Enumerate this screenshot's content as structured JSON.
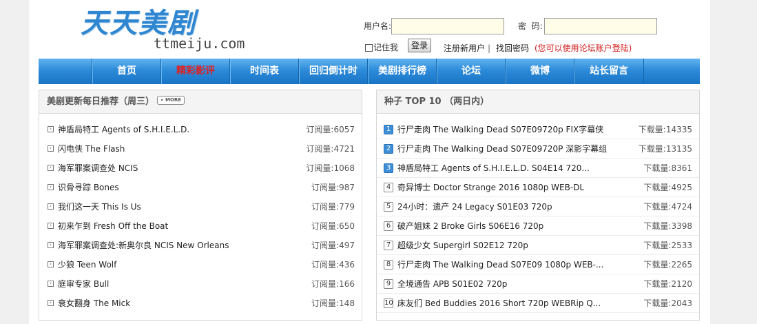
{
  "site": {
    "logo_cn": "天天美剧",
    "logo_en": "ttmeiju.com"
  },
  "login": {
    "username_label": "用户名:",
    "password_label": "密  码:",
    "remember_label": "记住我",
    "login_button": "登录",
    "register_link": "注册新用户",
    "separator": "|",
    "forgot_link": "找回密码",
    "forum_note": "(您可以使用论坛账户登陆)"
  },
  "nav": {
    "items": [
      {
        "label": "首页"
      },
      {
        "label": "精彩影评"
      },
      {
        "label": "时间表"
      },
      {
        "label": "回归倒计时"
      },
      {
        "label": "美剧排行榜"
      },
      {
        "label": "论坛"
      },
      {
        "label": "微博"
      },
      {
        "label": "站长留言"
      }
    ],
    "active_index": 1
  },
  "daily_panel": {
    "title": "美剧更新每日推荐（周三）",
    "more_label": "MORE",
    "count_prefix": "订阅量:",
    "items": [
      {
        "title": "神盾局特工 Agents of S.H.I.E.L.D.",
        "count": "订阅量:6057"
      },
      {
        "title": "闪电侠 The Flash",
        "count": "订阅量:4721"
      },
      {
        "title": "海军罪案调查处 NCIS",
        "count": "订阅量:1068"
      },
      {
        "title": "识骨寻踪 Bones",
        "count": "订阅量:987"
      },
      {
        "title": "我们这一天 This Is Us",
        "count": "订阅量:779"
      },
      {
        "title": "初来乍到 Fresh Off the Boat",
        "count": "订阅量:650"
      },
      {
        "title": "海军罪案调查处:新奥尔良 NCIS New Orleans",
        "count": "订阅量:497"
      },
      {
        "title": "少狼 Teen Wolf",
        "count": "订阅量:436"
      },
      {
        "title": "庭审专家 Bull",
        "count": "订阅量:166"
      },
      {
        "title": "衰女翻身 The Mick",
        "count": "订阅量:148"
      }
    ]
  },
  "top_panel": {
    "title": "种子 TOP 10 （两日内）",
    "items": [
      {
        "rank": "1",
        "title": "行尸走肉 The Walking Dead S07E09720p FIX字幕侠",
        "count": "下载量:14335"
      },
      {
        "rank": "2",
        "title": "行尸走肉 The Walking Dead S07E09720P 深影字幕组",
        "count": "下载量:13135"
      },
      {
        "rank": "3",
        "title": "神盾局特工 Agents of S.H.I.E.L.D. S04E14 720...",
        "count": "下载量:8361"
      },
      {
        "rank": "4",
        "title": "奇异博士 Doctor Strange 2016 1080p WEB-DL",
        "count": "下载量:4925"
      },
      {
        "rank": "5",
        "title": "24小时：遗产 24 Legacy S01E03 720p",
        "count": "下载量:4724"
      },
      {
        "rank": "6",
        "title": "破产姐妹 2 Broke Girls S06E16 720p",
        "count": "下载量:3398"
      },
      {
        "rank": "7",
        "title": "超级少女 Supergirl S02E12 720p",
        "count": "下载量:2533"
      },
      {
        "rank": "8",
        "title": "行尸走肉 The Walking Dead S07E09 1080p WEB-...",
        "count": "下载量:2265"
      },
      {
        "rank": "9",
        "title": "全境通告 APB S01E02 720p",
        "count": "下载量:2120"
      },
      {
        "rank": "10",
        "title": "床友们 Bed Buddies 2016 Short 720p WEBRip Q...",
        "count": "下载量:2043"
      }
    ]
  },
  "colors": {
    "nav_blue": "#2d8bd9",
    "nav_active": "#e21f1f",
    "rank_top": "#3d8fd8",
    "input_bg": "#fffce8",
    "note_red": "#d31f1f"
  }
}
